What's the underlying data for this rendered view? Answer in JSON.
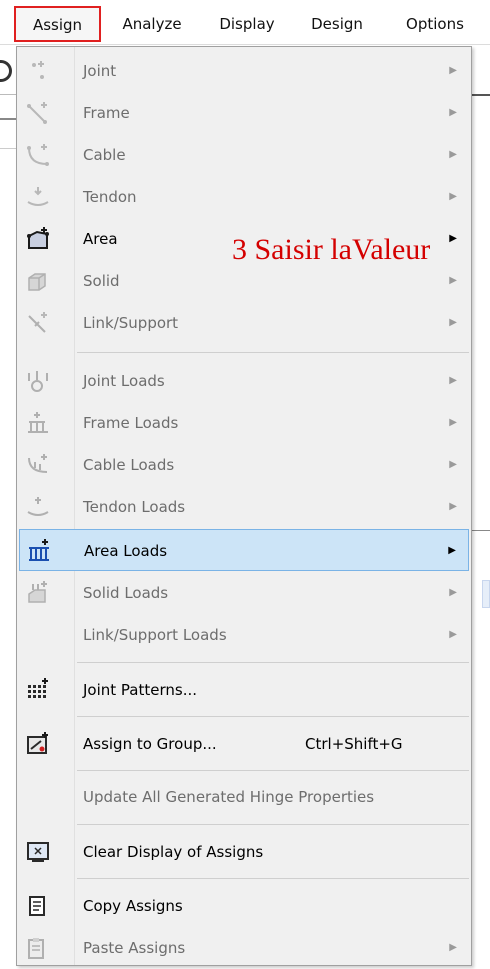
{
  "menubar": {
    "assign": "Assign",
    "analyze": "Analyze",
    "display": "Display",
    "design": "Design",
    "options": "Options"
  },
  "colors": {
    "highlight_bg": "#cce4f7",
    "highlight_border": "#7ab3e6",
    "annotation_red": "#d40000",
    "active_box_red": "#e02020"
  },
  "annotation": "3 Saisir laValeur",
  "menu": {
    "items": [
      {
        "label": "Joint",
        "icon": "joint-icon",
        "enabled": false,
        "submenu": true
      },
      {
        "label": "Frame",
        "icon": "frame-icon",
        "enabled": false,
        "submenu": true
      },
      {
        "label": "Cable",
        "icon": "cable-icon",
        "enabled": false,
        "submenu": true
      },
      {
        "label": "Tendon",
        "icon": "tendon-icon",
        "enabled": false,
        "submenu": true
      },
      {
        "label": "Area",
        "icon": "area-icon",
        "enabled": true,
        "submenu": true
      },
      {
        "label": "Solid",
        "icon": "solid-icon",
        "enabled": false,
        "submenu": true
      },
      {
        "label": "Link/Support",
        "icon": "link-support-icon",
        "enabled": false,
        "submenu": true
      },
      {
        "label": "Joint Loads",
        "icon": "joint-loads-icon",
        "enabled": false,
        "submenu": true
      },
      {
        "label": "Frame Loads",
        "icon": "frame-loads-icon",
        "enabled": false,
        "submenu": true
      },
      {
        "label": "Cable Loads",
        "icon": "cable-loads-icon",
        "enabled": false,
        "submenu": true
      },
      {
        "label": "Tendon Loads",
        "icon": "tendon-loads-icon",
        "enabled": false,
        "submenu": true
      },
      {
        "label": "Area Loads",
        "icon": "area-loads-icon",
        "enabled": true,
        "submenu": true,
        "highlighted": true
      },
      {
        "label": "Solid Loads",
        "icon": "solid-loads-icon",
        "enabled": false,
        "submenu": true
      },
      {
        "label": "Link/Support Loads",
        "icon": "",
        "enabled": false,
        "submenu": true
      },
      {
        "label": "Joint Patterns...",
        "icon": "joint-patterns-icon",
        "enabled": true,
        "submenu": false
      },
      {
        "label": "Assign to Group...",
        "icon": "assign-group-icon",
        "enabled": true,
        "submenu": false,
        "shortcut": "Ctrl+Shift+G"
      },
      {
        "label": "Update All Generated Hinge Properties",
        "icon": "",
        "enabled": false,
        "submenu": false
      },
      {
        "label": "Clear Display of Assigns",
        "icon": "clear-display-icon",
        "enabled": true,
        "submenu": false
      },
      {
        "label": "Copy Assigns",
        "icon": "copy-assigns-icon",
        "enabled": true,
        "submenu": false
      },
      {
        "label": "Paste Assigns",
        "icon": "paste-assigns-icon",
        "enabled": false,
        "submenu": true
      }
    ]
  }
}
